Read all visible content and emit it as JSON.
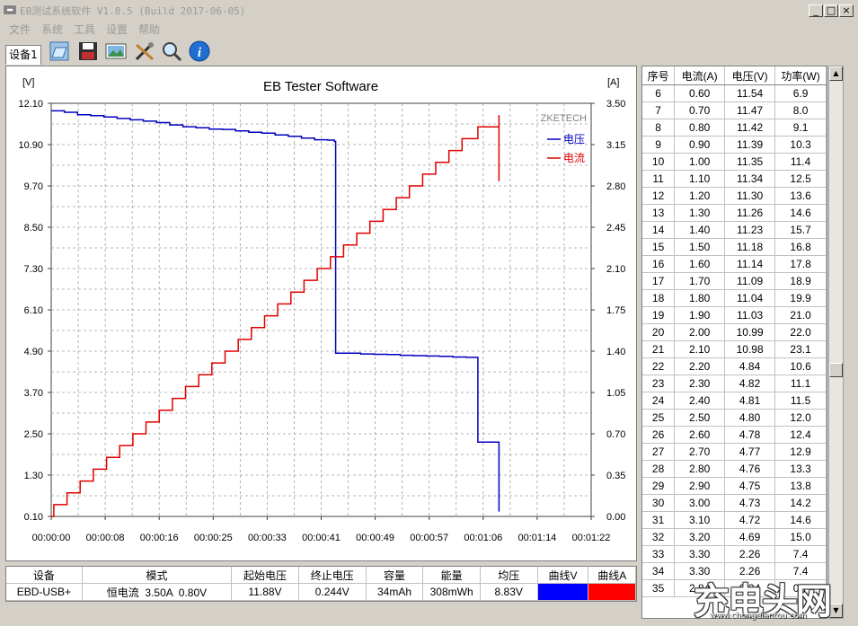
{
  "window": {
    "title": "EB测试系统软件 V1.8.5 (Build 2017-06-05)",
    "controls": [
      "_",
      "□",
      "×"
    ]
  },
  "menu": [
    "文件",
    "系统",
    "工具",
    "设置",
    "帮助"
  ],
  "toolbar": {
    "device_tab": "设备1",
    "buttons": [
      "open-file-icon",
      "save-icon",
      "picture-icon",
      "tools-icon",
      "magnifier-icon",
      "info-icon"
    ]
  },
  "chart_data": {
    "type": "line",
    "title": "EB Tester Software",
    "watermark": "ZKETECH",
    "left_unit": "[V]",
    "right_unit": "[A]",
    "y_left": {
      "min": 0.1,
      "max": 12.1,
      "ticks": [
        "12.10",
        "10.90",
        "9.70",
        "8.50",
        "7.30",
        "6.10",
        "4.90",
        "3.70",
        "2.50",
        "1.30",
        "0.10"
      ]
    },
    "y_right": {
      "min": 0.0,
      "max": 3.5,
      "ticks": [
        "3.50",
        "3.15",
        "2.80",
        "2.45",
        "2.10",
        "1.75",
        "1.40",
        "1.05",
        "0.70",
        "0.35",
        "0.00"
      ]
    },
    "x_ticks": [
      "00:00:00",
      "00:00:08",
      "00:00:16",
      "00:00:25",
      "00:00:33",
      "00:00:41",
      "00:00:49",
      "00:00:57",
      "00:01:06",
      "00:01:14",
      "00:01:22"
    ],
    "x_max_seconds": 82,
    "grid": true,
    "legend_position": "top-right",
    "series": [
      {
        "name": "电压",
        "axis": "left",
        "color": "#0000c0",
        "points": [
          [
            0,
            11.88
          ],
          [
            2,
            11.84
          ],
          [
            4,
            11.77
          ],
          [
            6,
            11.74
          ],
          [
            8,
            11.7
          ],
          [
            10,
            11.66
          ],
          [
            12,
            11.62
          ],
          [
            14,
            11.58
          ],
          [
            16,
            11.54
          ],
          [
            18,
            11.47
          ],
          [
            20,
            11.42
          ],
          [
            22,
            11.39
          ],
          [
            24,
            11.35
          ],
          [
            26,
            11.34
          ],
          [
            28,
            11.3
          ],
          [
            30,
            11.26
          ],
          [
            32,
            11.23
          ],
          [
            34,
            11.18
          ],
          [
            36,
            11.14
          ],
          [
            38,
            11.09
          ],
          [
            40,
            11.04
          ],
          [
            42,
            11.03
          ],
          [
            43,
            10.99
          ],
          [
            43.2,
            4.84
          ],
          [
            45,
            4.84
          ],
          [
            47,
            4.82
          ],
          [
            49,
            4.81
          ],
          [
            51,
            4.8
          ],
          [
            53,
            4.78
          ],
          [
            55,
            4.77
          ],
          [
            57,
            4.76
          ],
          [
            59,
            4.75
          ],
          [
            61,
            4.73
          ],
          [
            63,
            4.72
          ],
          [
            64.8,
            4.69
          ],
          [
            64.8,
            2.26
          ],
          [
            68,
            2.26
          ],
          [
            68,
            0.24
          ]
        ]
      },
      {
        "name": "电流",
        "axis": "right",
        "color": "#e00000",
        "points": [
          [
            0,
            0.0
          ],
          [
            0.4,
            0.1
          ],
          [
            2.4,
            0.2
          ],
          [
            4.4,
            0.3
          ],
          [
            6.4,
            0.4
          ],
          [
            8.4,
            0.5
          ],
          [
            10.4,
            0.6
          ],
          [
            12.4,
            0.7
          ],
          [
            14.4,
            0.8
          ],
          [
            16.4,
            0.9
          ],
          [
            18.4,
            1.0
          ],
          [
            20.4,
            1.1
          ],
          [
            22.4,
            1.2
          ],
          [
            24.4,
            1.3
          ],
          [
            26.4,
            1.4
          ],
          [
            28.4,
            1.5
          ],
          [
            30.4,
            1.6
          ],
          [
            32.4,
            1.7
          ],
          [
            34.4,
            1.8
          ],
          [
            36.4,
            1.9
          ],
          [
            38.4,
            2.0
          ],
          [
            40.4,
            2.1
          ],
          [
            42.4,
            2.2
          ],
          [
            44.4,
            2.3
          ],
          [
            46.4,
            2.4
          ],
          [
            48.4,
            2.5
          ],
          [
            50.4,
            2.6
          ],
          [
            52.4,
            2.7
          ],
          [
            54.4,
            2.8
          ],
          [
            56.4,
            2.9
          ],
          [
            58.4,
            3.0
          ],
          [
            60.4,
            3.1
          ],
          [
            62.4,
            3.2
          ],
          [
            64.8,
            3.3
          ],
          [
            68,
            3.3
          ],
          [
            68,
            3.4
          ],
          [
            68,
            2.84
          ]
        ]
      }
    ]
  },
  "table": {
    "headers": [
      "序号",
      "电流(A)",
      "电压(V)",
      "功率(W)"
    ],
    "rows": [
      [
        "6",
        "0.60",
        "11.54",
        "6.9"
      ],
      [
        "7",
        "0.70",
        "11.47",
        "8.0"
      ],
      [
        "8",
        "0.80",
        "11.42",
        "9.1"
      ],
      [
        "9",
        "0.90",
        "11.39",
        "10.3"
      ],
      [
        "10",
        "1.00",
        "11.35",
        "11.4"
      ],
      [
        "11",
        "1.10",
        "11.34",
        "12.5"
      ],
      [
        "12",
        "1.20",
        "11.30",
        "13.6"
      ],
      [
        "13",
        "1.30",
        "11.26",
        "14.6"
      ],
      [
        "14",
        "1.40",
        "11.23",
        "15.7"
      ],
      [
        "15",
        "1.50",
        "11.18",
        "16.8"
      ],
      [
        "16",
        "1.60",
        "11.14",
        "17.8"
      ],
      [
        "17",
        "1.70",
        "11.09",
        "18.9"
      ],
      [
        "18",
        "1.80",
        "11.04",
        "19.9"
      ],
      [
        "19",
        "1.90",
        "11.03",
        "21.0"
      ],
      [
        "20",
        "2.00",
        "10.99",
        "22.0"
      ],
      [
        "21",
        "2.10",
        "10.98",
        "23.1"
      ],
      [
        "22",
        "2.20",
        "4.84",
        "10.6"
      ],
      [
        "23",
        "2.30",
        "4.82",
        "11.1"
      ],
      [
        "24",
        "2.40",
        "4.81",
        "11.5"
      ],
      [
        "25",
        "2.50",
        "4.80",
        "12.0"
      ],
      [
        "26",
        "2.60",
        "4.78",
        "12.4"
      ],
      [
        "27",
        "2.70",
        "4.77",
        "12.9"
      ],
      [
        "28",
        "2.80",
        "4.76",
        "13.3"
      ],
      [
        "29",
        "2.90",
        "4.75",
        "13.8"
      ],
      [
        "30",
        "3.00",
        "4.73",
        "14.2"
      ],
      [
        "31",
        "3.10",
        "4.72",
        "14.6"
      ],
      [
        "32",
        "3.20",
        "4.69",
        "15.0"
      ],
      [
        "33",
        "3.30",
        "2.26",
        "7.4"
      ],
      [
        "34",
        "3.30",
        "2.26",
        "7.4"
      ],
      [
        "35",
        "2.84",
        "0.24",
        "0.7"
      ]
    ]
  },
  "status": {
    "headers": [
      "设备",
      "模式",
      "起始电压",
      "终止电压",
      "容量",
      "能量",
      "均压",
      "曲线V",
      "曲线A"
    ],
    "values": [
      "EBD-USB+",
      "恒电流  3.50A  0.80V",
      "11.88V",
      "0.244V",
      "34mAh",
      "308mWh",
      "8.83V",
      "",
      ""
    ],
    "curve_v_color": "#0000ff",
    "curve_a_color": "#ff0000"
  },
  "watermark": {
    "big": "充电头网",
    "small": "www.chongdiantou.com"
  }
}
